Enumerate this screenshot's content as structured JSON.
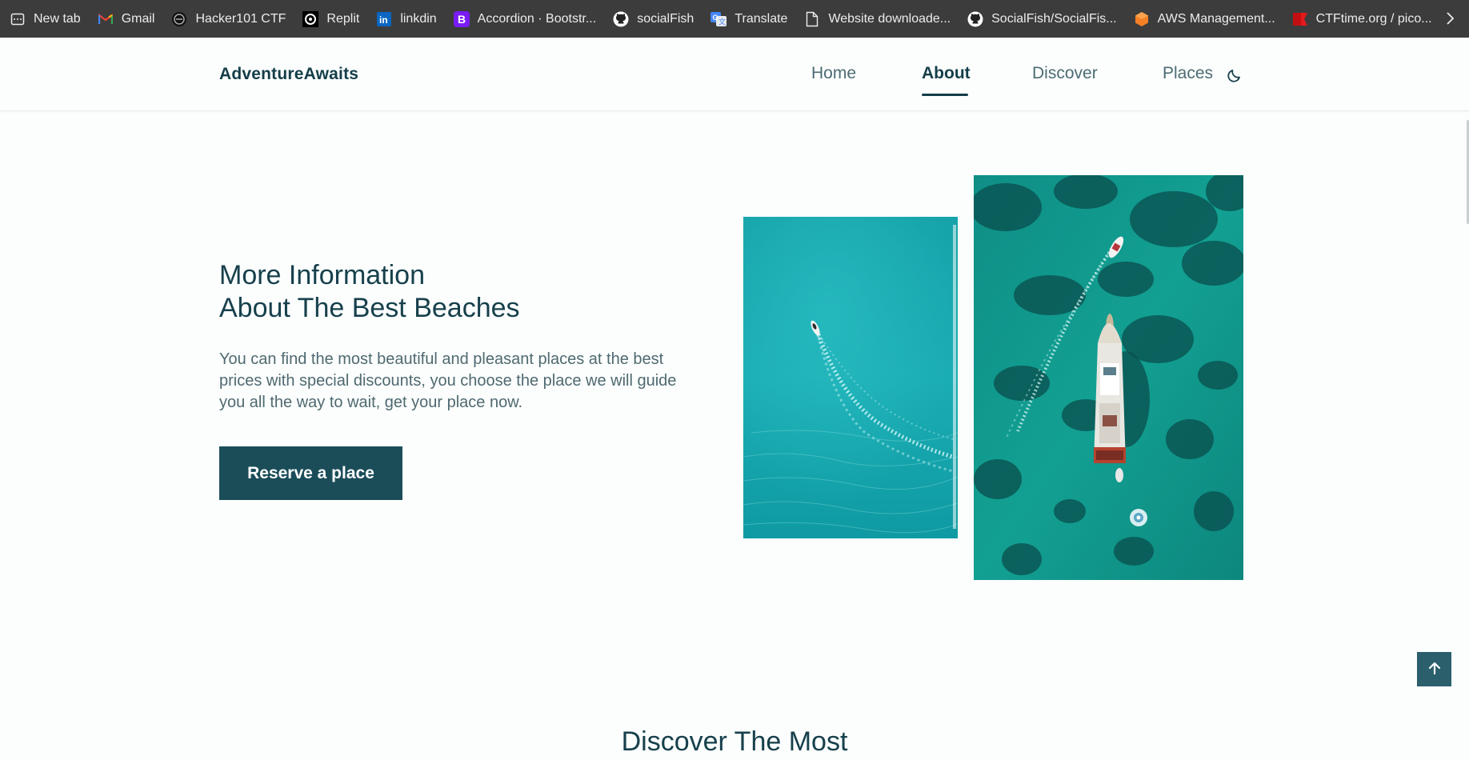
{
  "bookmarks": [
    {
      "label": "New tab",
      "icon": "new-tab-icon"
    },
    {
      "label": "Gmail",
      "icon": "gmail-icon"
    },
    {
      "label": "Hacker101 CTF",
      "icon": "hacker101-icon"
    },
    {
      "label": "Replit",
      "icon": "replit-icon"
    },
    {
      "label": "linkdin",
      "icon": "linkedin-icon"
    },
    {
      "label": "Accordion · Bootstr...",
      "icon": "bootstrap-icon"
    },
    {
      "label": "socialFish",
      "icon": "github-icon"
    },
    {
      "label": "Translate",
      "icon": "translate-icon"
    },
    {
      "label": "Website downloade...",
      "icon": "document-icon"
    },
    {
      "label": "SocialFish/SocialFis...",
      "icon": "github-icon"
    },
    {
      "label": "AWS Management...",
      "icon": "aws-icon"
    },
    {
      "label": "CTFtime.org / pico...",
      "icon": "ctftime-icon"
    }
  ],
  "header": {
    "logo": "AdventureAwaits",
    "nav": [
      {
        "label": "Home",
        "active": false
      },
      {
        "label": "About",
        "active": true
      },
      {
        "label": "Discover",
        "active": false
      },
      {
        "label": "Places",
        "active": false
      }
    ],
    "theme_icon": "moon-icon"
  },
  "about": {
    "title_line1": "More Information",
    "title_line2": "About The Best Beaches",
    "description": "You can find the most beautiful and pleasant places at the best prices with special discounts, you choose the place we will guide you all the way to wait, get your place now.",
    "button_label": "Reserve a place"
  },
  "discover": {
    "title": "Discover The Most"
  },
  "colors": {
    "primary": "#1b4d59",
    "title": "#17404c",
    "text": "#4f6970",
    "background": "#fbfefd",
    "bookmarks_bar": "#3c3c3c"
  }
}
